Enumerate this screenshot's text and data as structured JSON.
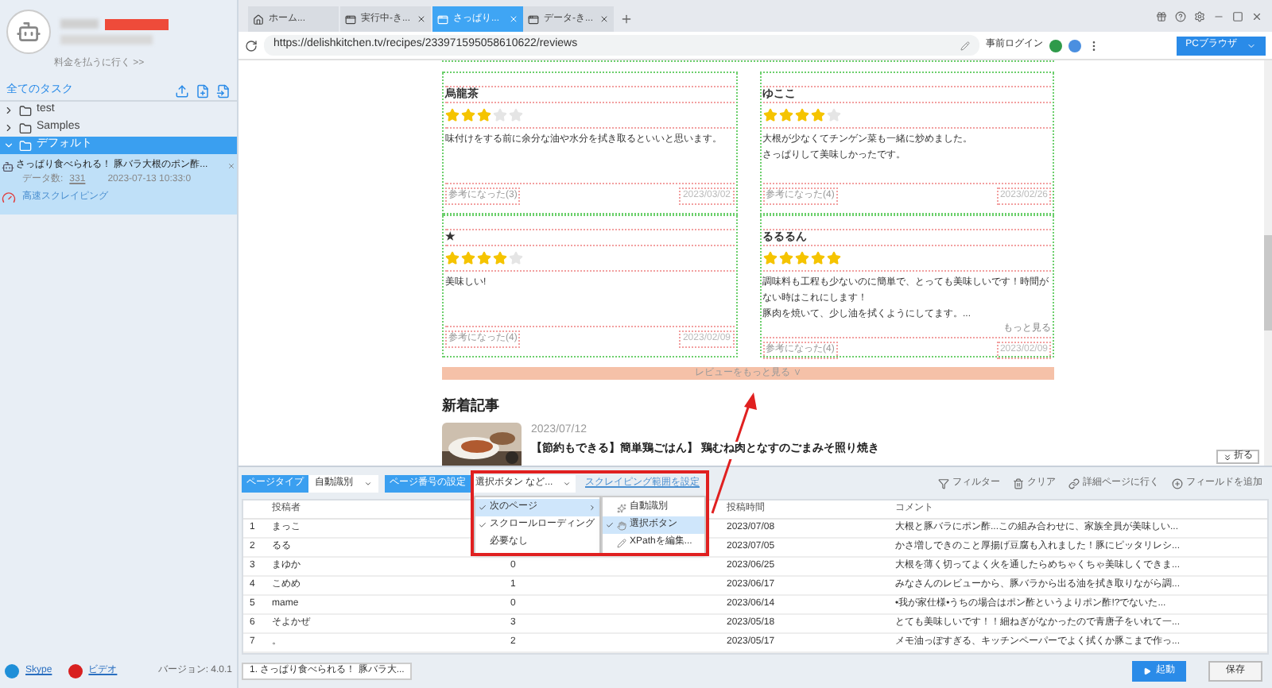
{
  "sidebar": {
    "pay_link": "料金を払うに行く >>",
    "all_tasks": "全てのタスク",
    "folders": [
      {
        "name": "test",
        "expanded": false,
        "selected": false
      },
      {
        "name": "Samples",
        "expanded": false,
        "selected": false
      },
      {
        "name": "デフォルト",
        "expanded": true,
        "selected": true,
        "children": [
          {
            "title": "さっぱり食べられる！ 豚バラ大根のポン酢...",
            "count_label": "データ数:",
            "count": "331",
            "time": "2023-07-13 10:33:0",
            "mode": "高速スクレイピング"
          }
        ]
      }
    ],
    "footer": {
      "skype": "Skype",
      "video": "ビデオ",
      "version": "バージョン: 4.0.1"
    }
  },
  "tabs": [
    {
      "label": "ホーム...",
      "kind": "home",
      "selected": false
    },
    {
      "label": "実行中-き...",
      "kind": "page",
      "selected": false
    },
    {
      "label": "さっぱり...",
      "kind": "page",
      "selected": true
    },
    {
      "label": "データ-き...",
      "kind": "page",
      "selected": false
    }
  ],
  "address_bar": {
    "url": "https://delishkitchen.tv/recipes/233971595058610622/reviews",
    "login": "事前ログイン",
    "browser": "PCブラウザ"
  },
  "reviews": [
    {
      "name": "烏龍茶",
      "stars": 3,
      "lines": [
        "味付けをする前に余分な油や水分を拭き取るといいと思います。"
      ],
      "helpful": "参考になった(3)",
      "date": "2023/03/02"
    },
    {
      "name": "ゆここ",
      "stars": 4,
      "lines": [
        "大根が少なくてチンゲン菜も一緒に炒めました。",
        "さっぱりして美味しかったです。"
      ],
      "helpful": "参考になった(4)",
      "date": "2023/02/26"
    },
    {
      "name": "★",
      "stars": 4,
      "lines": [
        "美味しい!"
      ],
      "helpful": "参考になった(4)",
      "date": "2023/02/09"
    },
    {
      "name": "るるるん",
      "stars": 5,
      "lines": [
        "調味料も工程も少ないのに簡単で、とっても美味しいです！時間がない時はこれにします！",
        "豚肉を焼いて、少し油を拭くようにしてます。..."
      ],
      "more": "もっと見る",
      "helpful": "参考になった(4)",
      "date": "2023/02/09"
    }
  ],
  "more_reviews": "レビューをもっと見る ∨",
  "articles": {
    "heading": "新着記事",
    "date": "2023/07/12",
    "title": "【節約もできる】簡単鶏ごはん】 鶏むね肉となすのごまみそ照り焼き"
  },
  "collapse": "折る",
  "toolbar": {
    "page_type_label": "ページタイプ",
    "page_type": "自動識別",
    "pagination_label": "ページ番号の設定",
    "pagination": "選択ボタン など...",
    "range_link": "スクレイピング範囲を設定",
    "actions": [
      "フィルター",
      "クリア",
      "詳細ページに行く",
      "フィールドを追加"
    ]
  },
  "menu": {
    "items": [
      {
        "label": "次のページ",
        "checked": true,
        "selected": true
      },
      {
        "label": "スクロールローディング",
        "checked": true,
        "selected": false
      },
      {
        "label": "必要なし",
        "checked": false,
        "selected": false
      }
    ],
    "submenu": [
      {
        "label": "自動識別",
        "checked": false,
        "selected": false
      },
      {
        "label": "選択ボタン",
        "checked": true,
        "selected": true
      },
      {
        "label": "XPathを編集...",
        "checked": false,
        "selected": false
      }
    ]
  },
  "table": {
    "columns": [
      "投稿者",
      "",
      "投稿時間",
      "コメント"
    ],
    "rows": [
      {
        "index": "1",
        "author": "まっこ",
        "time": "2023/07/08",
        "comment": "大根と豚バラにポン酢...この組み合わせに、家族全員が美味しい..."
      },
      {
        "index": "2",
        "author": "るる",
        "time": "2023/07/05",
        "comment": "かさ増しできのこと厚揚げ豆腐も入れました！豚にピッタリレシ..."
      },
      {
        "index": "3",
        "author": "まゆか",
        "column_3": "0",
        "time": "2023/06/25",
        "comment": "大根を薄く切ってよく火を通したらめちゃくちゃ美味しくできま..."
      },
      {
        "index": "4",
        "author": "こめめ",
        "column_3": "1",
        "time": "2023/06/17",
        "comment": "みなさんのレビューから、豚バラから出る油を拭き取りながら調..."
      },
      {
        "index": "5",
        "author": "mame",
        "column_3": "0",
        "time": "2023/06/14",
        "comment": "•我が家仕様•うちの場合はポン酢というよりポン酢!?でないた..."
      },
      {
        "index": "6",
        "author": "そよかぜ",
        "column_3": "3",
        "time": "2023/05/18",
        "comment": "とても美味しいです！！細ねぎがなかったので青唐子をいれて一..."
      },
      {
        "index": "7",
        "author": "。",
        "column_3": "2",
        "time": "2023/05/17",
        "comment": "メモ油っぽすぎる、キッチンペーパーでよく拭くか豚こまで作っ..."
      }
    ]
  },
  "task_tab": "1. さっぱり食べられる！ 豚バラ大...",
  "buttons": {
    "start": "起動",
    "save": "保存"
  }
}
